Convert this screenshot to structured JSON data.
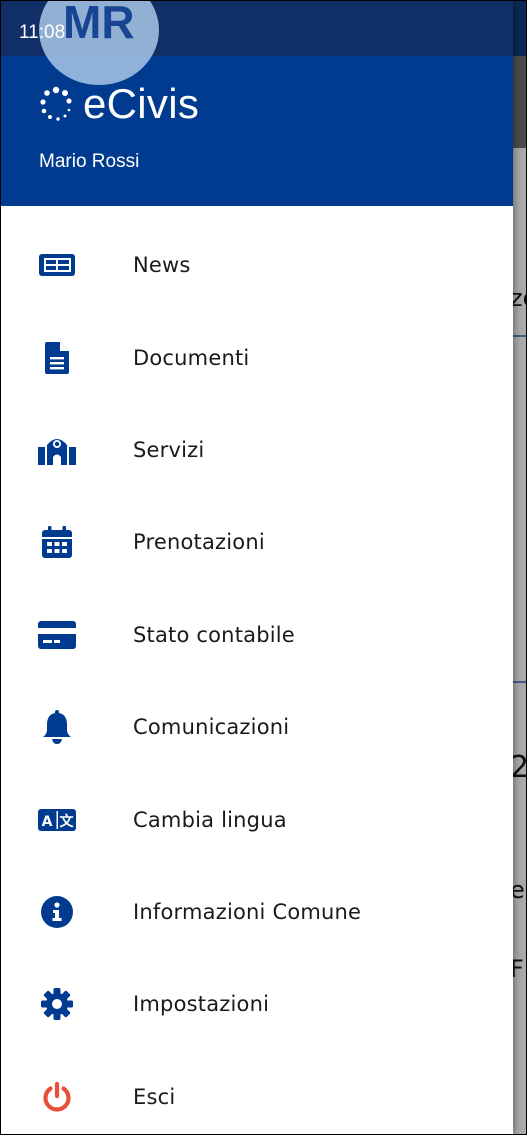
{
  "status_bar": {
    "time": "11:08"
  },
  "drawer": {
    "avatar_initials": "MR",
    "brand_name": "eCivis",
    "user_name": "Mario Rossi",
    "menu": [
      {
        "label": "News",
        "icon": "newspaper-icon"
      },
      {
        "label": "Documenti",
        "icon": "document-icon"
      },
      {
        "label": "Servizi",
        "icon": "town-hall-icon"
      },
      {
        "label": "Prenotazioni",
        "icon": "calendar-icon"
      },
      {
        "label": "Stato contabile",
        "icon": "credit-card-icon"
      },
      {
        "label": "Comunicazioni",
        "icon": "bell-icon"
      },
      {
        "label": "Cambia lingua",
        "icon": "translate-icon"
      },
      {
        "label": "Informazioni Comune",
        "icon": "info-icon"
      },
      {
        "label": "Impostazioni",
        "icon": "gear-icon"
      },
      {
        "label": "Esci",
        "icon": "power-icon"
      }
    ]
  },
  "background": {
    "fragments": [
      "zo",
      "2",
      "e",
      "FI"
    ]
  },
  "colors": {
    "header": "#003b8f",
    "status_bar": "#0f2f66",
    "icon": "#003b8f",
    "logout": "#e8503a",
    "avatar": "#a9c6e8"
  }
}
